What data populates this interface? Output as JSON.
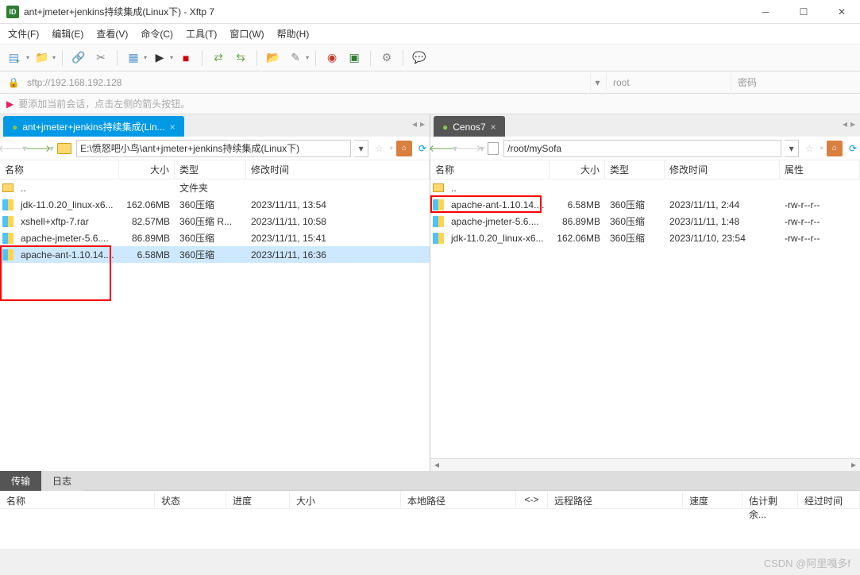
{
  "window": {
    "title": "ant+jmeter+jenkins持续集成(Linux下) - Xftp 7",
    "appIconText": "ID"
  },
  "menu": {
    "file": "文件(F)",
    "edit": "编辑(E)",
    "view": "查看(V)",
    "command": "命令(C)",
    "tool": "工具(T)",
    "window": "窗口(W)",
    "help": "帮助(H)"
  },
  "addr": {
    "url": "sftp://192.168.192.128",
    "user": "root",
    "passPlaceholder": "密码"
  },
  "infoBar": "要添加当前会话，点击左侧的箭头按钮。",
  "leftPanel": {
    "tabLabel": "ant+jmeter+jenkins持续集成(Lin...",
    "path": "E:\\愤怒吧小鸟\\ant+jmeter+jenkins持续集成(Linux下)",
    "columns": {
      "name": "名称",
      "size": "大小",
      "type": "类型",
      "modified": "修改时间"
    },
    "upDir": "..",
    "upType": "文件夹",
    "rows": [
      {
        "name": "jdk-11.0.20_linux-x6...",
        "size": "162.06MB",
        "type": "360压缩",
        "modified": "2023/11/11, 13:54"
      },
      {
        "name": "xshell+xftp-7.rar",
        "size": "82.57MB",
        "type": "360压缩 R...",
        "modified": "2023/11/11, 10:58"
      },
      {
        "name": "apache-jmeter-5.6....",
        "size": "86.89MB",
        "type": "360压缩",
        "modified": "2023/11/11, 15:41"
      },
      {
        "name": "apache-ant-1.10.14....",
        "size": "6.58MB",
        "type": "360压缩",
        "modified": "2023/11/11, 16:36"
      }
    ]
  },
  "rightPanel": {
    "tabLabel": "Cenos7",
    "path": "/root/mySofa",
    "columns": {
      "name": "名称",
      "size": "大小",
      "type": "类型",
      "modified": "修改时间",
      "attr": "属性"
    },
    "upDir": "..",
    "rows": [
      {
        "name": "apache-ant-1.10.14....",
        "size": "6.58MB",
        "type": "360压缩",
        "modified": "2023/11/11, 2:44",
        "attr": "-rw-r--r--"
      },
      {
        "name": "apache-jmeter-5.6....",
        "size": "86.89MB",
        "type": "360压缩",
        "modified": "2023/11/11, 1:48",
        "attr": "-rw-r--r--"
      },
      {
        "name": "jdk-11.0.20_linux-x6...",
        "size": "162.06MB",
        "type": "360压缩",
        "modified": "2023/11/10, 23:54",
        "attr": "-rw-r--r--"
      }
    ]
  },
  "bottomTabs": {
    "transfer": "传输",
    "log": "日志"
  },
  "transferCols": {
    "name": "名称",
    "status": "状态",
    "progress": "进度",
    "size": "大小",
    "localPath": "本地路径",
    "arrow": "<->",
    "remotePath": "远程路径",
    "speed": "速度",
    "eta": "估计剩余...",
    "elapsed": "经过时间"
  },
  "watermark": "CSDN @阿里嘎多f"
}
